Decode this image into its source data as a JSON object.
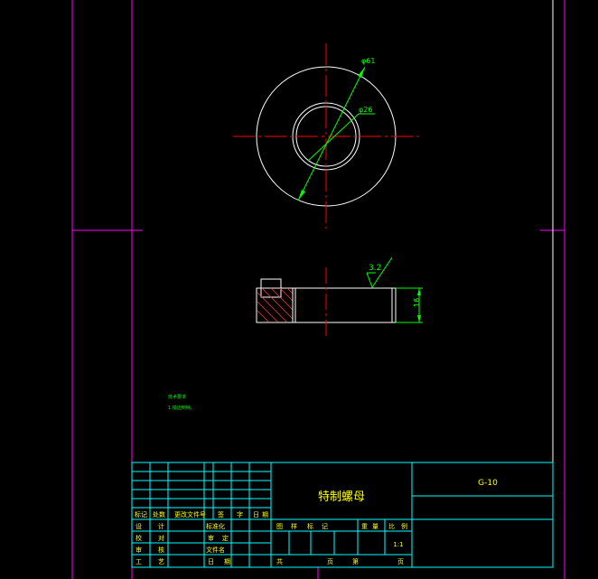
{
  "colors": {
    "background": "#000000",
    "border": "#ff00ff",
    "outline": "#ffffff",
    "centerline": "#ff0000",
    "dimension": "#00ff00",
    "titleblock": "#00ffff",
    "text": "#ffff00",
    "hatch": "#ff3333"
  },
  "top_view": {
    "dim_outer": "φ61",
    "dim_inner": "φ26"
  },
  "side_view": {
    "roughness": "3.2",
    "dim_height": "16"
  },
  "notes": {
    "title": "技术要求",
    "line1": "1.锐边倒钝。"
  },
  "title_block": {
    "part_name": "特制螺母",
    "drawing_no": "G-10",
    "header_cells": [
      "标记",
      "处数",
      "更改文件号",
      "签",
      "字",
      "日",
      "期"
    ],
    "left_rows": [
      {
        "a": "设",
        "b": "计",
        "c": "标准化"
      },
      {
        "a": "校",
        "b": "对",
        "c": "审",
        "d": "定"
      },
      {
        "a": "审",
        "b": "核",
        "c": "文件名"
      },
      {
        "a": "工",
        "b": "艺",
        "c": "日",
        "d": "期"
      }
    ],
    "mid_header": [
      "图",
      "样",
      "标",
      "记",
      "重",
      "量",
      "比",
      "例"
    ],
    "scale": "1:1",
    "sheet_row": [
      "共",
      "页",
      "第",
      "页"
    ]
  }
}
